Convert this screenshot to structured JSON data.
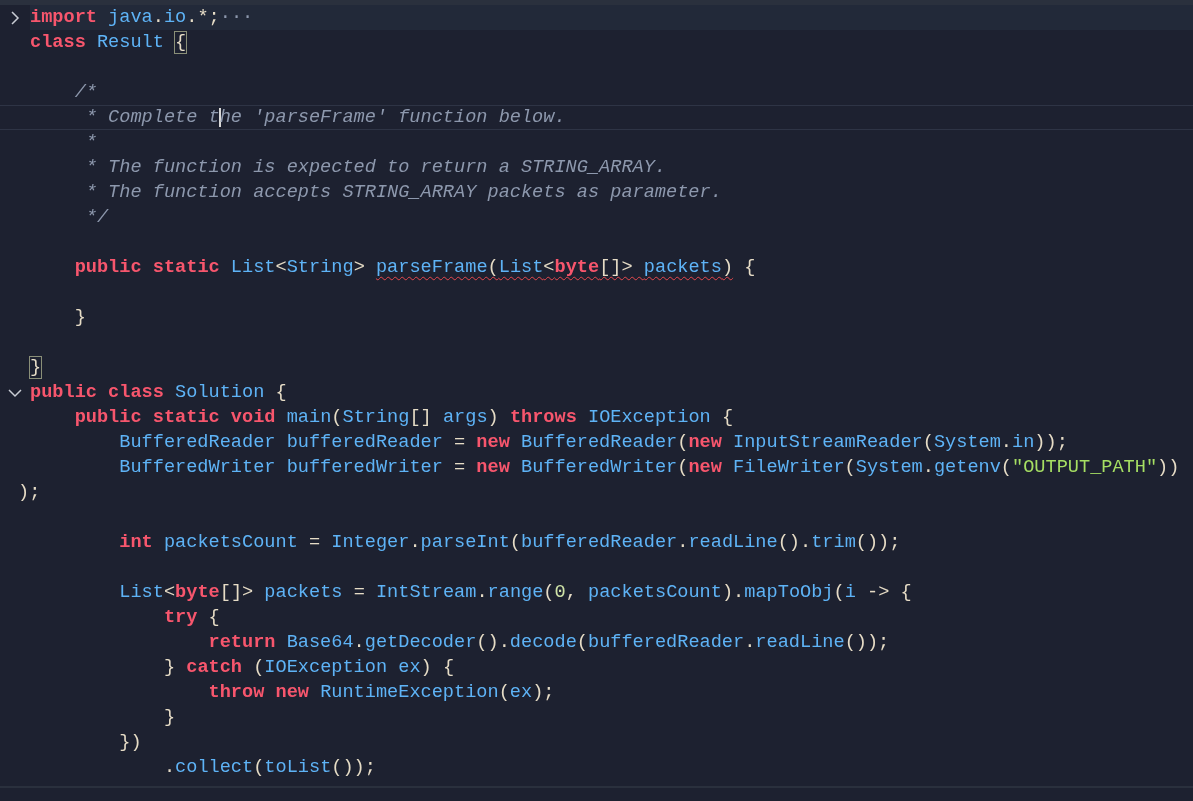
{
  "editor": {
    "lines": [
      {
        "current": false,
        "fold": {
          "expanded": false
        },
        "tokens": [
          {
            "kind": "kw",
            "text": "import "
          },
          {
            "kind": "id",
            "text": "java"
          },
          {
            "kind": "p",
            "text": "."
          },
          {
            "kind": "id",
            "text": "io"
          },
          {
            "kind": "p",
            "text": ".*;"
          },
          {
            "kind": "dots",
            "text": "···"
          }
        ]
      },
      {
        "current": false,
        "tokens": [
          {
            "kind": "kw",
            "text": "class "
          },
          {
            "kind": "id",
            "text": "Result "
          },
          {
            "kind": "brace",
            "text": "{"
          }
        ]
      },
      {
        "current": false
      },
      {
        "current": false,
        "tokens": [
          {
            "kind": "cm",
            "text": "    /*"
          }
        ]
      },
      {
        "current": true,
        "tokens": [
          {
            "kind": "cm",
            "text": "     * Complete t"
          },
          {
            "kind": "caret"
          },
          {
            "kind": "cm",
            "text": "he 'parseFrame' function below."
          }
        ]
      },
      {
        "current": false,
        "tokens": [
          {
            "kind": "cm",
            "text": "     *"
          }
        ]
      },
      {
        "current": false,
        "tokens": [
          {
            "kind": "cm",
            "text": "     * The function is expected to return a STRING_ARRAY."
          }
        ]
      },
      {
        "current": false,
        "tokens": [
          {
            "kind": "cm",
            "text": "     * The function accepts STRING_ARRAY packets as parameter."
          }
        ]
      },
      {
        "current": false,
        "tokens": [
          {
            "kind": "cm",
            "text": "     */"
          }
        ]
      },
      {
        "current": false
      },
      {
        "current": false,
        "tokens": [
          {
            "kind": "kw",
            "text": "    public "
          },
          {
            "kind": "kw",
            "text": "static "
          },
          {
            "kind": "id",
            "text": "List"
          },
          {
            "kind": "p",
            "text": "<"
          },
          {
            "kind": "id",
            "text": "String"
          },
          {
            "kind": "p",
            "text": "> "
          },
          {
            "kind": "err",
            "tokens": [
              {
                "kind": "id",
                "text": "parseFrame"
              },
              {
                "kind": "p",
                "text": "("
              },
              {
                "kind": "id",
                "text": "List"
              },
              {
                "kind": "p",
                "text": "<"
              },
              {
                "kind": "kw",
                "text": "byte"
              },
              {
                "kind": "p",
                "text": "[]> "
              },
              {
                "kind": "id",
                "text": "packets"
              },
              {
                "kind": "p",
                "text": ")"
              }
            ]
          },
          {
            "kind": "p",
            "text": " {"
          }
        ]
      },
      {
        "current": false
      },
      {
        "current": false,
        "tokens": [
          {
            "kind": "p",
            "text": "    }"
          }
        ]
      },
      {
        "current": false
      },
      {
        "current": false,
        "tokens": [
          {
            "kind": "brace",
            "text": "}"
          }
        ]
      },
      {
        "current": false,
        "fold": {
          "expanded": true
        },
        "tokens": [
          {
            "kind": "kw",
            "text": "public "
          },
          {
            "kind": "kw",
            "text": "class "
          },
          {
            "kind": "id",
            "text": "Solution"
          },
          {
            "kind": "p",
            "text": " {"
          }
        ]
      },
      {
        "current": false,
        "tokens": [
          {
            "kind": "kw",
            "text": "    public "
          },
          {
            "kind": "kw",
            "text": "static "
          },
          {
            "kind": "kw",
            "text": "void "
          },
          {
            "kind": "id",
            "text": "main"
          },
          {
            "kind": "p",
            "text": "("
          },
          {
            "kind": "id",
            "text": "String"
          },
          {
            "kind": "p",
            "text": "[] "
          },
          {
            "kind": "id",
            "text": "args"
          },
          {
            "kind": "p",
            "text": ") "
          },
          {
            "kind": "kw",
            "text": "throws "
          },
          {
            "kind": "id",
            "text": "IOException"
          },
          {
            "kind": "p",
            "text": " {"
          }
        ]
      },
      {
        "current": false,
        "tokens": [
          {
            "kind": "id",
            "text": "        BufferedReader "
          },
          {
            "kind": "id",
            "text": "bufferedReader"
          },
          {
            "kind": "p",
            "text": " = "
          },
          {
            "kind": "kw",
            "text": "new "
          },
          {
            "kind": "id",
            "text": "BufferedReader"
          },
          {
            "kind": "p",
            "text": "("
          },
          {
            "kind": "kw",
            "text": "new "
          },
          {
            "kind": "id",
            "text": "InputStreamReader"
          },
          {
            "kind": "p",
            "text": "("
          },
          {
            "kind": "id",
            "text": "System"
          },
          {
            "kind": "p",
            "text": "."
          },
          {
            "kind": "id",
            "text": "in"
          },
          {
            "kind": "p",
            "text": "));"
          }
        ]
      },
      {
        "current": false,
        "tokens": [
          {
            "kind": "id",
            "text": "        BufferedWriter "
          },
          {
            "kind": "id",
            "text": "bufferedWriter"
          },
          {
            "kind": "p",
            "text": " = "
          },
          {
            "kind": "kw",
            "text": "new "
          },
          {
            "kind": "id",
            "text": "BufferedWriter"
          },
          {
            "kind": "p",
            "text": "("
          },
          {
            "kind": "kw",
            "text": "new "
          },
          {
            "kind": "id",
            "text": "FileWriter"
          },
          {
            "kind": "p",
            "text": "("
          },
          {
            "kind": "id",
            "text": "System"
          },
          {
            "kind": "p",
            "text": "."
          },
          {
            "kind": "id",
            "text": "getenv"
          },
          {
            "kind": "p",
            "text": "("
          },
          {
            "kind": "str",
            "text": "\"OUTPUT_PATH\""
          },
          {
            "kind": "p",
            "text": "))"
          }
        ]
      },
      {
        "current": false,
        "wrapped": true,
        "tokens": [
          {
            "kind": "p",
            "text": ");"
          }
        ]
      },
      {
        "current": false
      },
      {
        "current": false,
        "tokens": [
          {
            "kind": "kw",
            "text": "        int "
          },
          {
            "kind": "id",
            "text": "packetsCount"
          },
          {
            "kind": "p",
            "text": " = "
          },
          {
            "kind": "id",
            "text": "Integer"
          },
          {
            "kind": "p",
            "text": "."
          },
          {
            "kind": "id",
            "text": "parseInt"
          },
          {
            "kind": "p",
            "text": "("
          },
          {
            "kind": "id",
            "text": "bufferedReader"
          },
          {
            "kind": "p",
            "text": "."
          },
          {
            "kind": "id",
            "text": "readLine"
          },
          {
            "kind": "p",
            "text": "()."
          },
          {
            "kind": "id",
            "text": "trim"
          },
          {
            "kind": "p",
            "text": "());"
          }
        ]
      },
      {
        "current": false
      },
      {
        "current": false,
        "tokens": [
          {
            "kind": "id",
            "text": "        List"
          },
          {
            "kind": "p",
            "text": "<"
          },
          {
            "kind": "kw",
            "text": "byte"
          },
          {
            "kind": "p",
            "text": "[]> "
          },
          {
            "kind": "id",
            "text": "packets"
          },
          {
            "kind": "p",
            "text": " = "
          },
          {
            "kind": "id",
            "text": "IntStream"
          },
          {
            "kind": "p",
            "text": "."
          },
          {
            "kind": "id",
            "text": "range"
          },
          {
            "kind": "p",
            "text": "("
          },
          {
            "kind": "num",
            "text": "0"
          },
          {
            "kind": "p",
            "text": ", "
          },
          {
            "kind": "id",
            "text": "packetsCount"
          },
          {
            "kind": "p",
            "text": ")."
          },
          {
            "kind": "id",
            "text": "mapToObj"
          },
          {
            "kind": "p",
            "text": "("
          },
          {
            "kind": "id",
            "text": "i"
          },
          {
            "kind": "p",
            "text": " -> {"
          }
        ]
      },
      {
        "current": false,
        "tokens": [
          {
            "kind": "kw",
            "text": "            try"
          },
          {
            "kind": "p",
            "text": " {"
          }
        ]
      },
      {
        "current": false,
        "tokens": [
          {
            "kind": "kw",
            "text": "                return "
          },
          {
            "kind": "id",
            "text": "Base64"
          },
          {
            "kind": "p",
            "text": "."
          },
          {
            "kind": "id",
            "text": "getDecoder"
          },
          {
            "kind": "p",
            "text": "()."
          },
          {
            "kind": "id",
            "text": "decode"
          },
          {
            "kind": "p",
            "text": "("
          },
          {
            "kind": "id",
            "text": "bufferedReader"
          },
          {
            "kind": "p",
            "text": "."
          },
          {
            "kind": "id",
            "text": "readLine"
          },
          {
            "kind": "p",
            "text": "());"
          }
        ]
      },
      {
        "current": false,
        "tokens": [
          {
            "kind": "p",
            "text": "            } "
          },
          {
            "kind": "kw",
            "text": "catch"
          },
          {
            "kind": "p",
            "text": " ("
          },
          {
            "kind": "id",
            "text": "IOException "
          },
          {
            "kind": "id",
            "text": "ex"
          },
          {
            "kind": "p",
            "text": ") {"
          }
        ]
      },
      {
        "current": false,
        "tokens": [
          {
            "kind": "kw",
            "text": "                throw "
          },
          {
            "kind": "kw",
            "text": "new "
          },
          {
            "kind": "id",
            "text": "RuntimeException"
          },
          {
            "kind": "p",
            "text": "("
          },
          {
            "kind": "id",
            "text": "ex"
          },
          {
            "kind": "p",
            "text": ");"
          }
        ]
      },
      {
        "current": false,
        "tokens": [
          {
            "kind": "p",
            "text": "            }"
          }
        ]
      },
      {
        "current": false,
        "tokens": [
          {
            "kind": "p",
            "text": "        })"
          }
        ]
      },
      {
        "current": false,
        "tokens": [
          {
            "kind": "p",
            "text": "            ."
          },
          {
            "kind": "id",
            "text": "collect"
          },
          {
            "kind": "p",
            "text": "("
          },
          {
            "kind": "id",
            "text": "toList"
          },
          {
            "kind": "p",
            "text": "());"
          }
        ]
      }
    ]
  }
}
